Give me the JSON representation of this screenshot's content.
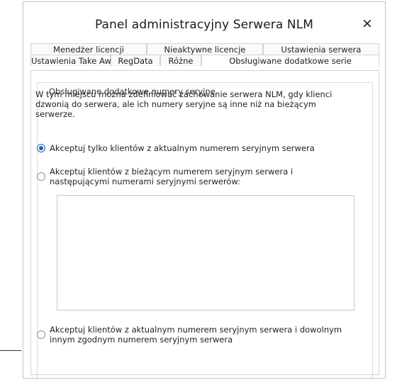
{
  "dialog": {
    "title": "Panel administracyjny Serwera NLM",
    "close_symbol": "×"
  },
  "tabs": {
    "row1": [
      "Menedżer licencji",
      "Nieaktywne licencje",
      "Ustawienia serwera"
    ],
    "row2": [
      "Ustawienia Take Away",
      "RegData",
      "Różne",
      "Obsługiwane dodatkowe serie"
    ],
    "active": "Obsługiwane dodatkowe serie"
  },
  "group": {
    "legend": "Obsługiwane dodatkowe numery seryjne",
    "description_lines": [
      "W tym miejscu można zdefiniować zachowanie serwera NLM, gdy klienci",
      "dzwonią do serwera, ale ich numery seryjne są inne niż na bieżącym",
      "serwerze."
    ]
  },
  "options": [
    {
      "lines": [
        "Akceptuj tylko klientów z aktualnym numerem seryjnym serwera"
      ],
      "selected": true
    },
    {
      "lines": [
        "Akceptuj klientów z bieżącym numerem seryjnym serwera i",
        "następującymi numerami seryjnymi serwerów:"
      ],
      "selected": false
    },
    {
      "lines": [
        "Akceptuj klientów z aktualnym numerem seryjnym serwera i dowolnym",
        "innym zgodnym numerem seryjnym serwera"
      ],
      "selected": false
    }
  ],
  "colors": {
    "accent": "#1d5fb8",
    "border": "#d3d3d3"
  }
}
